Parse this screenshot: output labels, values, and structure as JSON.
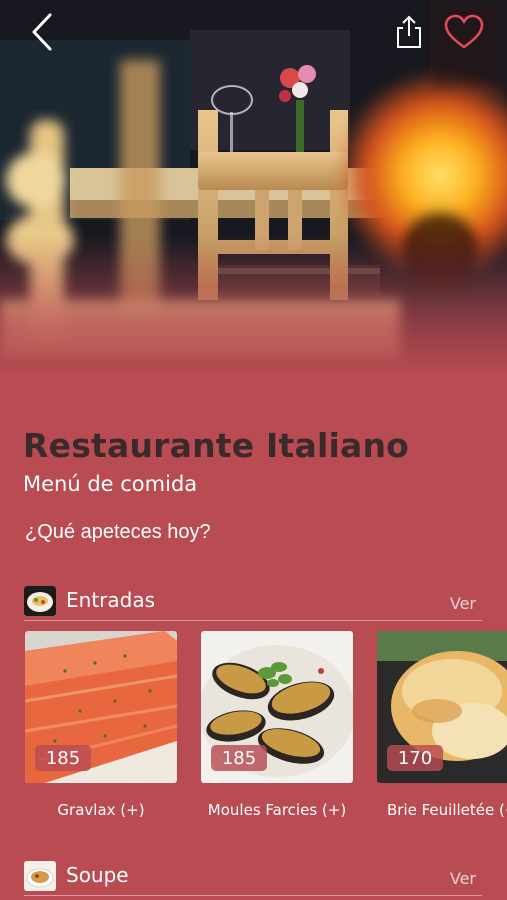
{
  "restaurant": {
    "name": "Restaurante Italiano",
    "subtitle": "Menú de comida",
    "question": "¿Qué apeteces hoy?"
  },
  "header": {
    "back_icon": "chevron-left-icon",
    "share_icon": "share-icon",
    "favorite_icon": "heart-outline-icon"
  },
  "sections": [
    {
      "title": "Entradas",
      "view_label": "Ver",
      "items": [
        {
          "name": "Gravlax (+)",
          "price": "185"
        },
        {
          "name": "Moules Farcies (+)",
          "price": "185"
        },
        {
          "name": "Brie Feuilletée (+)",
          "price": "170"
        }
      ]
    },
    {
      "title": "Soupe",
      "view_label": "Ver"
    }
  ],
  "colors": {
    "background": "#b84c52",
    "title_text": "#3b2a2c",
    "text": "#ffffff"
  }
}
